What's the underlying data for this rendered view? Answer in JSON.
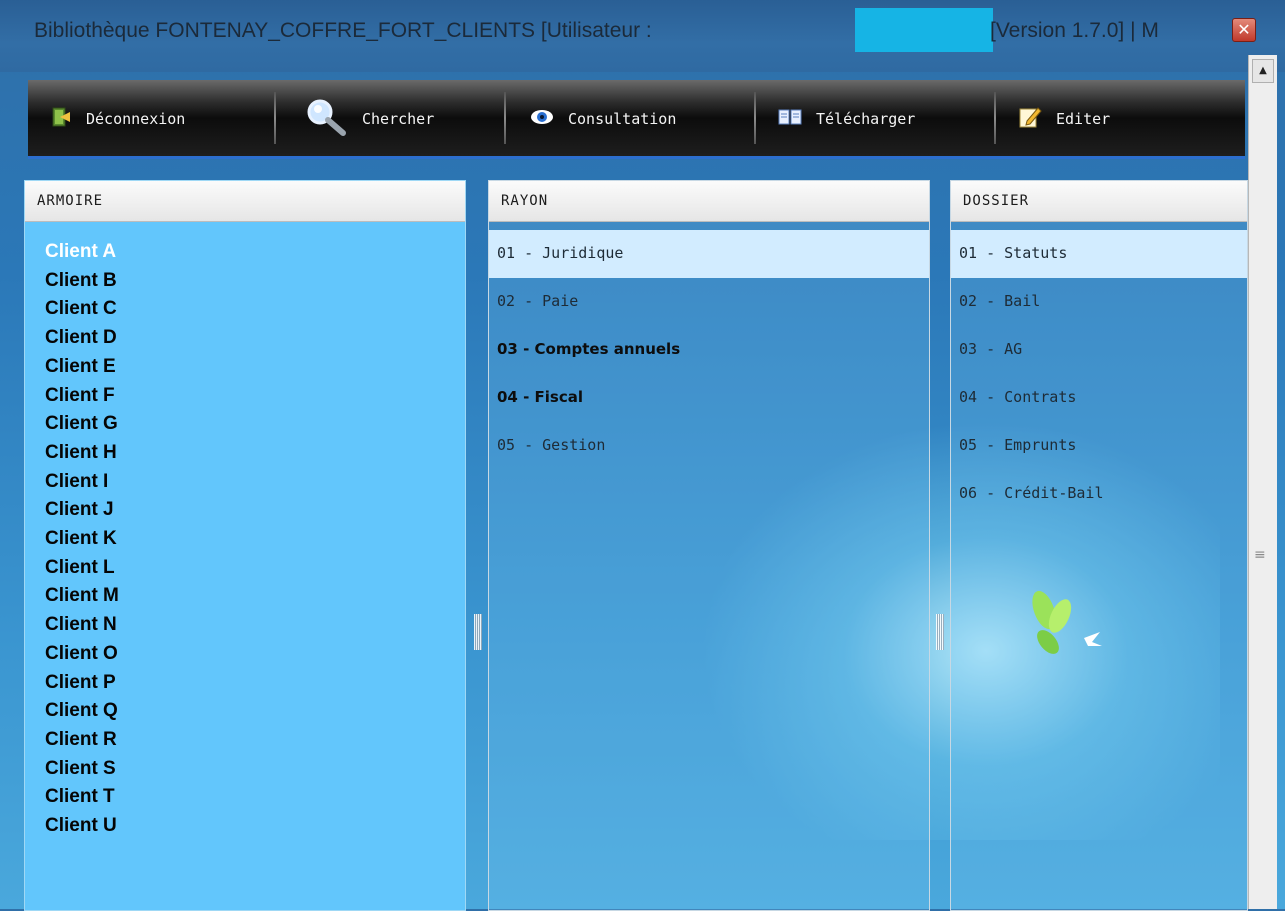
{
  "window": {
    "title_left": "Bibliothèque FONTENAY_COFFRE_FORT_CLIENTS [Utilisateur :",
    "title_right": "[Version 1.7.0] | M",
    "close_label": "✕"
  },
  "toolbar": {
    "buttons": [
      {
        "label": "Déconnexion",
        "icon": "logout-door-icon"
      },
      {
        "label": "Chercher",
        "icon": "magnifier-icon"
      },
      {
        "label": "Consultation",
        "icon": "eye-icon"
      },
      {
        "label": "Télécharger",
        "icon": "open-book-icon"
      },
      {
        "label": "Editer",
        "icon": "edit-pencil-icon"
      }
    ]
  },
  "armoire": {
    "header": "ARMOIRE",
    "selected": "Client A",
    "items": [
      "Client A",
      "Client B",
      "Client C",
      "Client D",
      "Client E",
      "Client F",
      "Client G",
      "Client H",
      "Client I",
      "Client J",
      "Client K",
      "Client L",
      "Client M",
      "Client N",
      "Client O",
      "Client P",
      "Client Q",
      "Client R",
      "Client S",
      "Client T",
      "Client U"
    ]
  },
  "rayon": {
    "header": "RAYON",
    "selected": "01 - Juridique",
    "items": [
      {
        "label": "01 - Juridique",
        "bold": false
      },
      {
        "label": "02 - Paie",
        "bold": false
      },
      {
        "label": "03 - Comptes annuels",
        "bold": true
      },
      {
        "label": "04 - Fiscal",
        "bold": true
      },
      {
        "label": "05 - Gestion",
        "bold": false
      }
    ]
  },
  "dossier": {
    "header": "DOSSIER",
    "selected": "01 - Statuts",
    "items": [
      "01 - Statuts",
      "02 - Bail",
      "03 - AG",
      "04 - Contrats",
      "05 - Emprunts",
      "06 - Crédit-Bail"
    ]
  },
  "colors": {
    "armoire_bg": "#62c6fc",
    "selected_row": "#d2ecff",
    "toolbar_accent": "#2c6fcf",
    "user_redaction": "#16b4e5"
  }
}
